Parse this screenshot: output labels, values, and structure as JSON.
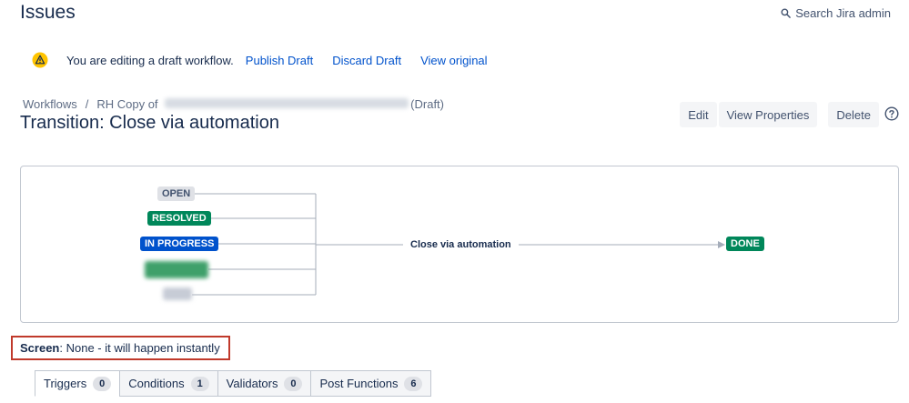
{
  "header": {
    "title": "Issues",
    "search_label": "Search Jira admin"
  },
  "draft_bar": {
    "message": "You are editing a draft workflow.",
    "publish_label": "Publish Draft",
    "discard_label": "Discard Draft",
    "view_original_label": "View original"
  },
  "breadcrumb": {
    "workflows": "Workflows",
    "separator": "/",
    "copy_prefix": "RH Copy of",
    "draft_suffix": "(Draft)"
  },
  "transition_title": "Transition: Close via automation",
  "actions": {
    "edit": "Edit",
    "view_properties": "View Properties",
    "delete": "Delete"
  },
  "diagram": {
    "from_statuses": [
      "OPEN",
      "RESOLVED",
      "IN PROGRESS"
    ],
    "transition_name": "Close via automation",
    "to_status": "DONE"
  },
  "screen": {
    "label": "Screen",
    "value": ": None - it will happen instantly"
  },
  "tabs": [
    {
      "label": "Triggers",
      "count": "0"
    },
    {
      "label": "Conditions",
      "count": "1"
    },
    {
      "label": "Validators",
      "count": "0"
    },
    {
      "label": "Post Functions",
      "count": "6"
    }
  ],
  "colors": {
    "link": "#0052cc",
    "success": "#00875a",
    "in_progress": "#0052cc",
    "highlight_box": "#c0392b"
  }
}
